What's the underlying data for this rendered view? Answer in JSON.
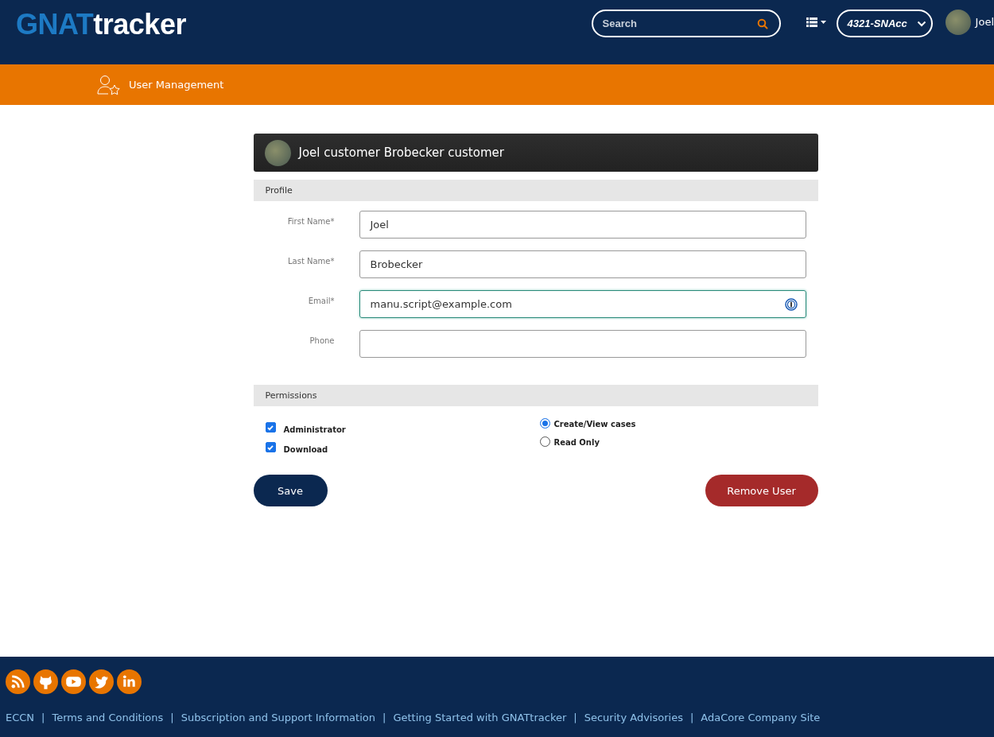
{
  "header": {
    "logo": {
      "prefix": "GNAT",
      "suffix": "tracker"
    },
    "search": {
      "placeholder": "Search"
    },
    "account_select": {
      "value": "4321-SNAcc"
    },
    "user": {
      "name": "Joel"
    }
  },
  "nav": {
    "items": [
      {
        "label": "User Management",
        "selected": true
      }
    ]
  },
  "user_card": {
    "title": "Joel customer Brobecker customer"
  },
  "profile": {
    "heading": "Profile",
    "fields": [
      {
        "label": "First Name*",
        "value": "Joel",
        "focused": false,
        "password_manager": false
      },
      {
        "label": "Last Name*",
        "value": "Brobecker",
        "focused": false,
        "password_manager": false
      },
      {
        "label": "Email*",
        "value": "manu.script@example.com",
        "focused": true,
        "password_manager": true
      },
      {
        "label": "Phone",
        "focused": false,
        "password_manager": false
      }
    ]
  },
  "permissions": {
    "heading": "Permissions",
    "checkboxes": [
      {
        "label": "Administrator",
        "checked": true
      },
      {
        "label": "Download",
        "checked": true
      }
    ],
    "radios": [
      {
        "label": "Create/View cases",
        "selected": true
      },
      {
        "label": "Read Only",
        "selected": false
      }
    ]
  },
  "buttons": [
    {
      "label": "Save",
      "kind": "primary"
    },
    {
      "label": "Remove User",
      "kind": "danger"
    }
  ],
  "footer": {
    "social": [
      {
        "kind": "rss"
      },
      {
        "kind": "github"
      },
      {
        "kind": "youtube"
      },
      {
        "kind": "twitter"
      },
      {
        "kind": "linkedin"
      }
    ],
    "separator": "|",
    "links": [
      "ECCN",
      "Terms and Conditions",
      "Subscription and Support Information",
      "Getting Started with GNATtracker",
      "Security Advisories",
      "AdaCore Company Site"
    ]
  }
}
